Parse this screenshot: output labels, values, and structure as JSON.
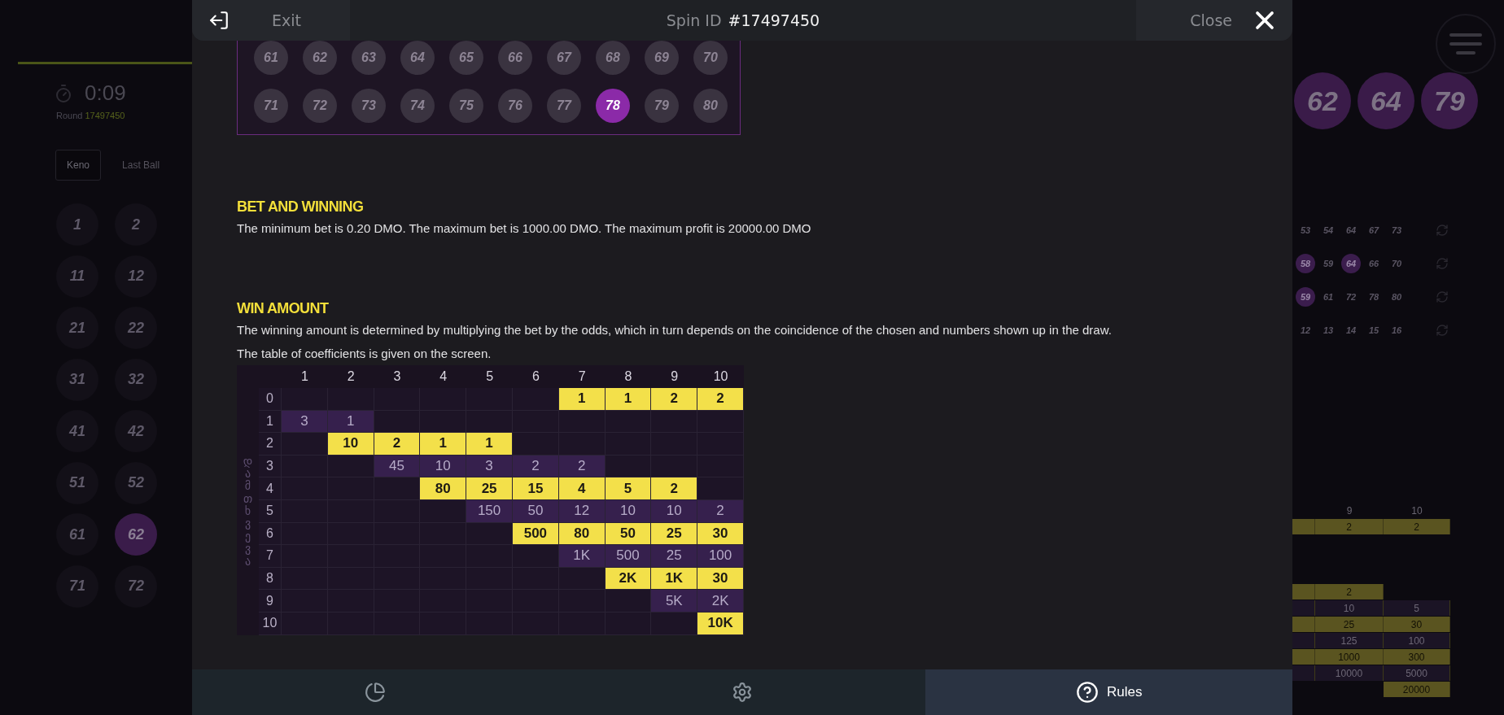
{
  "background_left": {
    "timer": "0:09",
    "round_label": "Round",
    "round_number": "17497450",
    "tabs": [
      {
        "label": "Keno",
        "selected": true
      },
      {
        "label": "Last Ball",
        "selected": false
      }
    ],
    "balls": [
      {
        "number": "1",
        "selected": false
      },
      {
        "number": "2",
        "selected": false
      },
      {
        "number": "11",
        "selected": false
      },
      {
        "number": "12",
        "selected": false
      },
      {
        "number": "21",
        "selected": false
      },
      {
        "number": "22",
        "selected": false
      },
      {
        "number": "31",
        "selected": false
      },
      {
        "number": "32",
        "selected": false
      },
      {
        "number": "41",
        "selected": false
      },
      {
        "number": "42",
        "selected": false
      },
      {
        "number": "51",
        "selected": false
      },
      {
        "number": "52",
        "selected": false
      },
      {
        "number": "61",
        "selected": false
      },
      {
        "number": "62",
        "selected": true
      },
      {
        "number": "71",
        "selected": false
      },
      {
        "number": "72",
        "selected": false
      }
    ]
  },
  "modal": {
    "exit": "Exit",
    "spin_id_label": "Spin ID",
    "spin_id": "#17497450",
    "close": "Close",
    "ball_rows": [
      [
        {
          "number": "61",
          "selected": false
        },
        {
          "number": "62",
          "selected": false
        },
        {
          "number": "63",
          "selected": false
        },
        {
          "number": "64",
          "selected": false
        },
        {
          "number": "65",
          "selected": false
        },
        {
          "number": "66",
          "selected": false
        },
        {
          "number": "67",
          "selected": false
        },
        {
          "number": "68",
          "selected": false
        },
        {
          "number": "69",
          "selected": false
        },
        {
          "number": "70",
          "selected": false
        }
      ],
      [
        {
          "number": "71",
          "selected": false
        },
        {
          "number": "72",
          "selected": false
        },
        {
          "number": "73",
          "selected": false
        },
        {
          "number": "74",
          "selected": false
        },
        {
          "number": "75",
          "selected": false
        },
        {
          "number": "76",
          "selected": false
        },
        {
          "number": "77",
          "selected": false
        },
        {
          "number": "78",
          "selected": true
        },
        {
          "number": "79",
          "selected": false
        },
        {
          "number": "80",
          "selected": false
        }
      ]
    ],
    "sections": [
      {
        "title": "BET AND WINNING",
        "paragraphs": [
          "The minimum bet is 0.20 DMO. The maximum bet is 1000.00 DMO. The maximum profit is 20000.00 DMO"
        ]
      },
      {
        "title": "WIN AMOUNT",
        "paragraphs": [
          "The winning amount is determined by multiplying the bet by the odds, which in turn depends on the coincidence of the chosen and numbers shown up in the draw.",
          "The table of coefficients is given on the screen."
        ]
      }
    ],
    "paytable": {
      "side_label": "დამთხვევა",
      "columns": [
        "1",
        "2",
        "3",
        "4",
        "5",
        "6",
        "7",
        "8",
        "9",
        "10"
      ],
      "rows": [
        {
          "hits": "0",
          "cells": [
            {
              "kind": "empty"
            },
            {
              "kind": "empty"
            },
            {
              "kind": "empty"
            },
            {
              "kind": "empty"
            },
            {
              "kind": "empty"
            },
            {
              "kind": "empty"
            },
            {
              "kind": "high",
              "value": "1"
            },
            {
              "kind": "high",
              "value": "1"
            },
            {
              "kind": "high",
              "value": "2"
            },
            {
              "kind": "high",
              "value": "2"
            }
          ]
        },
        {
          "hits": "1",
          "cells": [
            {
              "kind": "low",
              "value": "3"
            },
            {
              "kind": "low",
              "value": "1"
            },
            {
              "kind": "empty"
            },
            {
              "kind": "empty"
            },
            {
              "kind": "empty"
            },
            {
              "kind": "empty"
            },
            {
              "kind": "empty"
            },
            {
              "kind": "empty"
            },
            {
              "kind": "empty"
            },
            {
              "kind": "empty"
            }
          ]
        },
        {
          "hits": "2",
          "cells": [
            {
              "kind": "empty"
            },
            {
              "kind": "high",
              "value": "10"
            },
            {
              "kind": "high",
              "value": "2"
            },
            {
              "kind": "high",
              "value": "1"
            },
            {
              "kind": "high",
              "value": "1"
            },
            {
              "kind": "empty"
            },
            {
              "kind": "empty"
            },
            {
              "kind": "empty"
            },
            {
              "kind": "empty"
            },
            {
              "kind": "empty"
            }
          ]
        },
        {
          "hits": "3",
          "cells": [
            {
              "kind": "empty"
            },
            {
              "kind": "empty"
            },
            {
              "kind": "low",
              "value": "45"
            },
            {
              "kind": "low",
              "value": "10"
            },
            {
              "kind": "low",
              "value": "3"
            },
            {
              "kind": "low",
              "value": "2"
            },
            {
              "kind": "low",
              "value": "2"
            },
            {
              "kind": "empty"
            },
            {
              "kind": "empty"
            },
            {
              "kind": "empty"
            }
          ]
        },
        {
          "hits": "4",
          "cells": [
            {
              "kind": "empty"
            },
            {
              "kind": "empty"
            },
            {
              "kind": "empty"
            },
            {
              "kind": "high",
              "value": "80"
            },
            {
              "kind": "high",
              "value": "25"
            },
            {
              "kind": "high",
              "value": "15"
            },
            {
              "kind": "high",
              "value": "4"
            },
            {
              "kind": "high",
              "value": "5"
            },
            {
              "kind": "high",
              "value": "2"
            },
            {
              "kind": "empty"
            }
          ]
        },
        {
          "hits": "5",
          "cells": [
            {
              "kind": "empty"
            },
            {
              "kind": "empty"
            },
            {
              "kind": "empty"
            },
            {
              "kind": "empty"
            },
            {
              "kind": "low",
              "value": "150"
            },
            {
              "kind": "low",
              "value": "50"
            },
            {
              "kind": "low",
              "value": "12"
            },
            {
              "kind": "low",
              "value": "10"
            },
            {
              "kind": "low",
              "value": "10"
            },
            {
              "kind": "low",
              "value": "2"
            }
          ]
        },
        {
          "hits": "6",
          "cells": [
            {
              "kind": "empty"
            },
            {
              "kind": "empty"
            },
            {
              "kind": "empty"
            },
            {
              "kind": "empty"
            },
            {
              "kind": "empty"
            },
            {
              "kind": "high",
              "value": "500"
            },
            {
              "kind": "high",
              "value": "80"
            },
            {
              "kind": "high",
              "value": "50"
            },
            {
              "kind": "high",
              "value": "25"
            },
            {
              "kind": "high",
              "value": "30"
            }
          ]
        },
        {
          "hits": "7",
          "cells": [
            {
              "kind": "empty"
            },
            {
              "kind": "empty"
            },
            {
              "kind": "empty"
            },
            {
              "kind": "empty"
            },
            {
              "kind": "empty"
            },
            {
              "kind": "empty"
            },
            {
              "kind": "low",
              "value": "1K"
            },
            {
              "kind": "low",
              "value": "500"
            },
            {
              "kind": "low",
              "value": "25"
            },
            {
              "kind": "low",
              "value": "100"
            }
          ]
        },
        {
          "hits": "8",
          "cells": [
            {
              "kind": "empty"
            },
            {
              "kind": "empty"
            },
            {
              "kind": "empty"
            },
            {
              "kind": "empty"
            },
            {
              "kind": "empty"
            },
            {
              "kind": "empty"
            },
            {
              "kind": "empty"
            },
            {
              "kind": "high",
              "value": "2K"
            },
            {
              "kind": "high",
              "value": "1K"
            },
            {
              "kind": "high",
              "value": "30"
            }
          ]
        },
        {
          "hits": "9",
          "cells": [
            {
              "kind": "empty"
            },
            {
              "kind": "empty"
            },
            {
              "kind": "empty"
            },
            {
              "kind": "empty"
            },
            {
              "kind": "empty"
            },
            {
              "kind": "empty"
            },
            {
              "kind": "empty"
            },
            {
              "kind": "empty"
            },
            {
              "kind": "low",
              "value": "5K"
            },
            {
              "kind": "low",
              "value": "2K"
            }
          ]
        },
        {
          "hits": "10",
          "cells": [
            {
              "kind": "empty"
            },
            {
              "kind": "empty"
            },
            {
              "kind": "empty"
            },
            {
              "kind": "empty"
            },
            {
              "kind": "empty"
            },
            {
              "kind": "empty"
            },
            {
              "kind": "empty"
            },
            {
              "kind": "empty"
            },
            {
              "kind": "empty"
            },
            {
              "kind": "high",
              "value": "10K"
            }
          ]
        }
      ]
    },
    "bottom_tabs": [
      {
        "kind": "stats",
        "selected": false
      },
      {
        "kind": "settings",
        "selected": false
      },
      {
        "kind": "rules",
        "label": "Rules",
        "selected": true
      }
    ]
  },
  "background_right": {
    "drawn_balls": [
      "62",
      "64",
      "79"
    ],
    "tickets": [
      {
        "numbers": [
          {
            "number": "53",
            "selected": false
          },
          {
            "number": "54",
            "selected": false
          },
          {
            "number": "64",
            "selected": false
          },
          {
            "number": "67",
            "selected": false
          },
          {
            "number": "73",
            "selected": false
          }
        ]
      },
      {
        "numbers": [
          {
            "number": "58",
            "selected": true
          },
          {
            "number": "59",
            "selected": false
          },
          {
            "number": "64",
            "selected": true
          },
          {
            "number": "66",
            "selected": false
          },
          {
            "number": "70",
            "selected": false
          }
        ]
      },
      {
        "numbers": [
          {
            "number": "59",
            "selected": true
          },
          {
            "number": "61",
            "selected": false
          },
          {
            "number": "72",
            "selected": false
          },
          {
            "number": "78",
            "selected": false
          },
          {
            "number": "80",
            "selected": false
          }
        ]
      },
      {
        "numbers": [
          {
            "number": "12",
            "selected": false
          },
          {
            "number": "13",
            "selected": false
          },
          {
            "number": "14",
            "selected": false
          },
          {
            "number": "15",
            "selected": false
          },
          {
            "number": "16",
            "selected": false
          }
        ]
      }
    ],
    "paytable": {
      "columns": [
        "",
        "9",
        "10"
      ],
      "rows": [
        {
          "cells": [
            {
              "kind": "high"
            },
            {
              "kind": "high",
              "value": "2"
            },
            {
              "kind": "high",
              "value": "2"
            }
          ]
        },
        {
          "cells": [
            {
              "kind": "empty"
            },
            {
              "kind": "empty"
            },
            {
              "kind": "empty"
            }
          ]
        },
        {
          "cells": [
            {
              "kind": "empty"
            },
            {
              "kind": "empty"
            },
            {
              "kind": "empty"
            }
          ]
        },
        {
          "cells": [
            {
              "kind": "empty"
            },
            {
              "kind": "empty"
            },
            {
              "kind": "empty"
            }
          ]
        },
        {
          "cells": [
            {
              "kind": "high"
            },
            {
              "kind": "high",
              "value": "2"
            },
            {
              "kind": "empty"
            }
          ]
        },
        {
          "cells": [
            {
              "kind": "low"
            },
            {
              "kind": "low",
              "value": "10"
            },
            {
              "kind": "low",
              "value": "5"
            }
          ]
        },
        {
          "cells": [
            {
              "kind": "high"
            },
            {
              "kind": "high",
              "value": "25"
            },
            {
              "kind": "high",
              "value": "30"
            }
          ]
        },
        {
          "cells": [
            {
              "kind": "low"
            },
            {
              "kind": "low",
              "value": "125"
            },
            {
              "kind": "low",
              "value": "100"
            }
          ]
        },
        {
          "cells": [
            {
              "kind": "high"
            },
            {
              "kind": "high",
              "value": "1000"
            },
            {
              "kind": "high",
              "value": "300"
            }
          ]
        },
        {
          "cells": [
            {
              "kind": "low"
            },
            {
              "kind": "low",
              "value": "10000"
            },
            {
              "kind": "low",
              "value": "5000"
            }
          ]
        },
        {
          "cells": [
            {
              "kind": "empty"
            },
            {
              "kind": "empty"
            },
            {
              "kind": "high",
              "value": "20000"
            }
          ]
        }
      ]
    }
  }
}
